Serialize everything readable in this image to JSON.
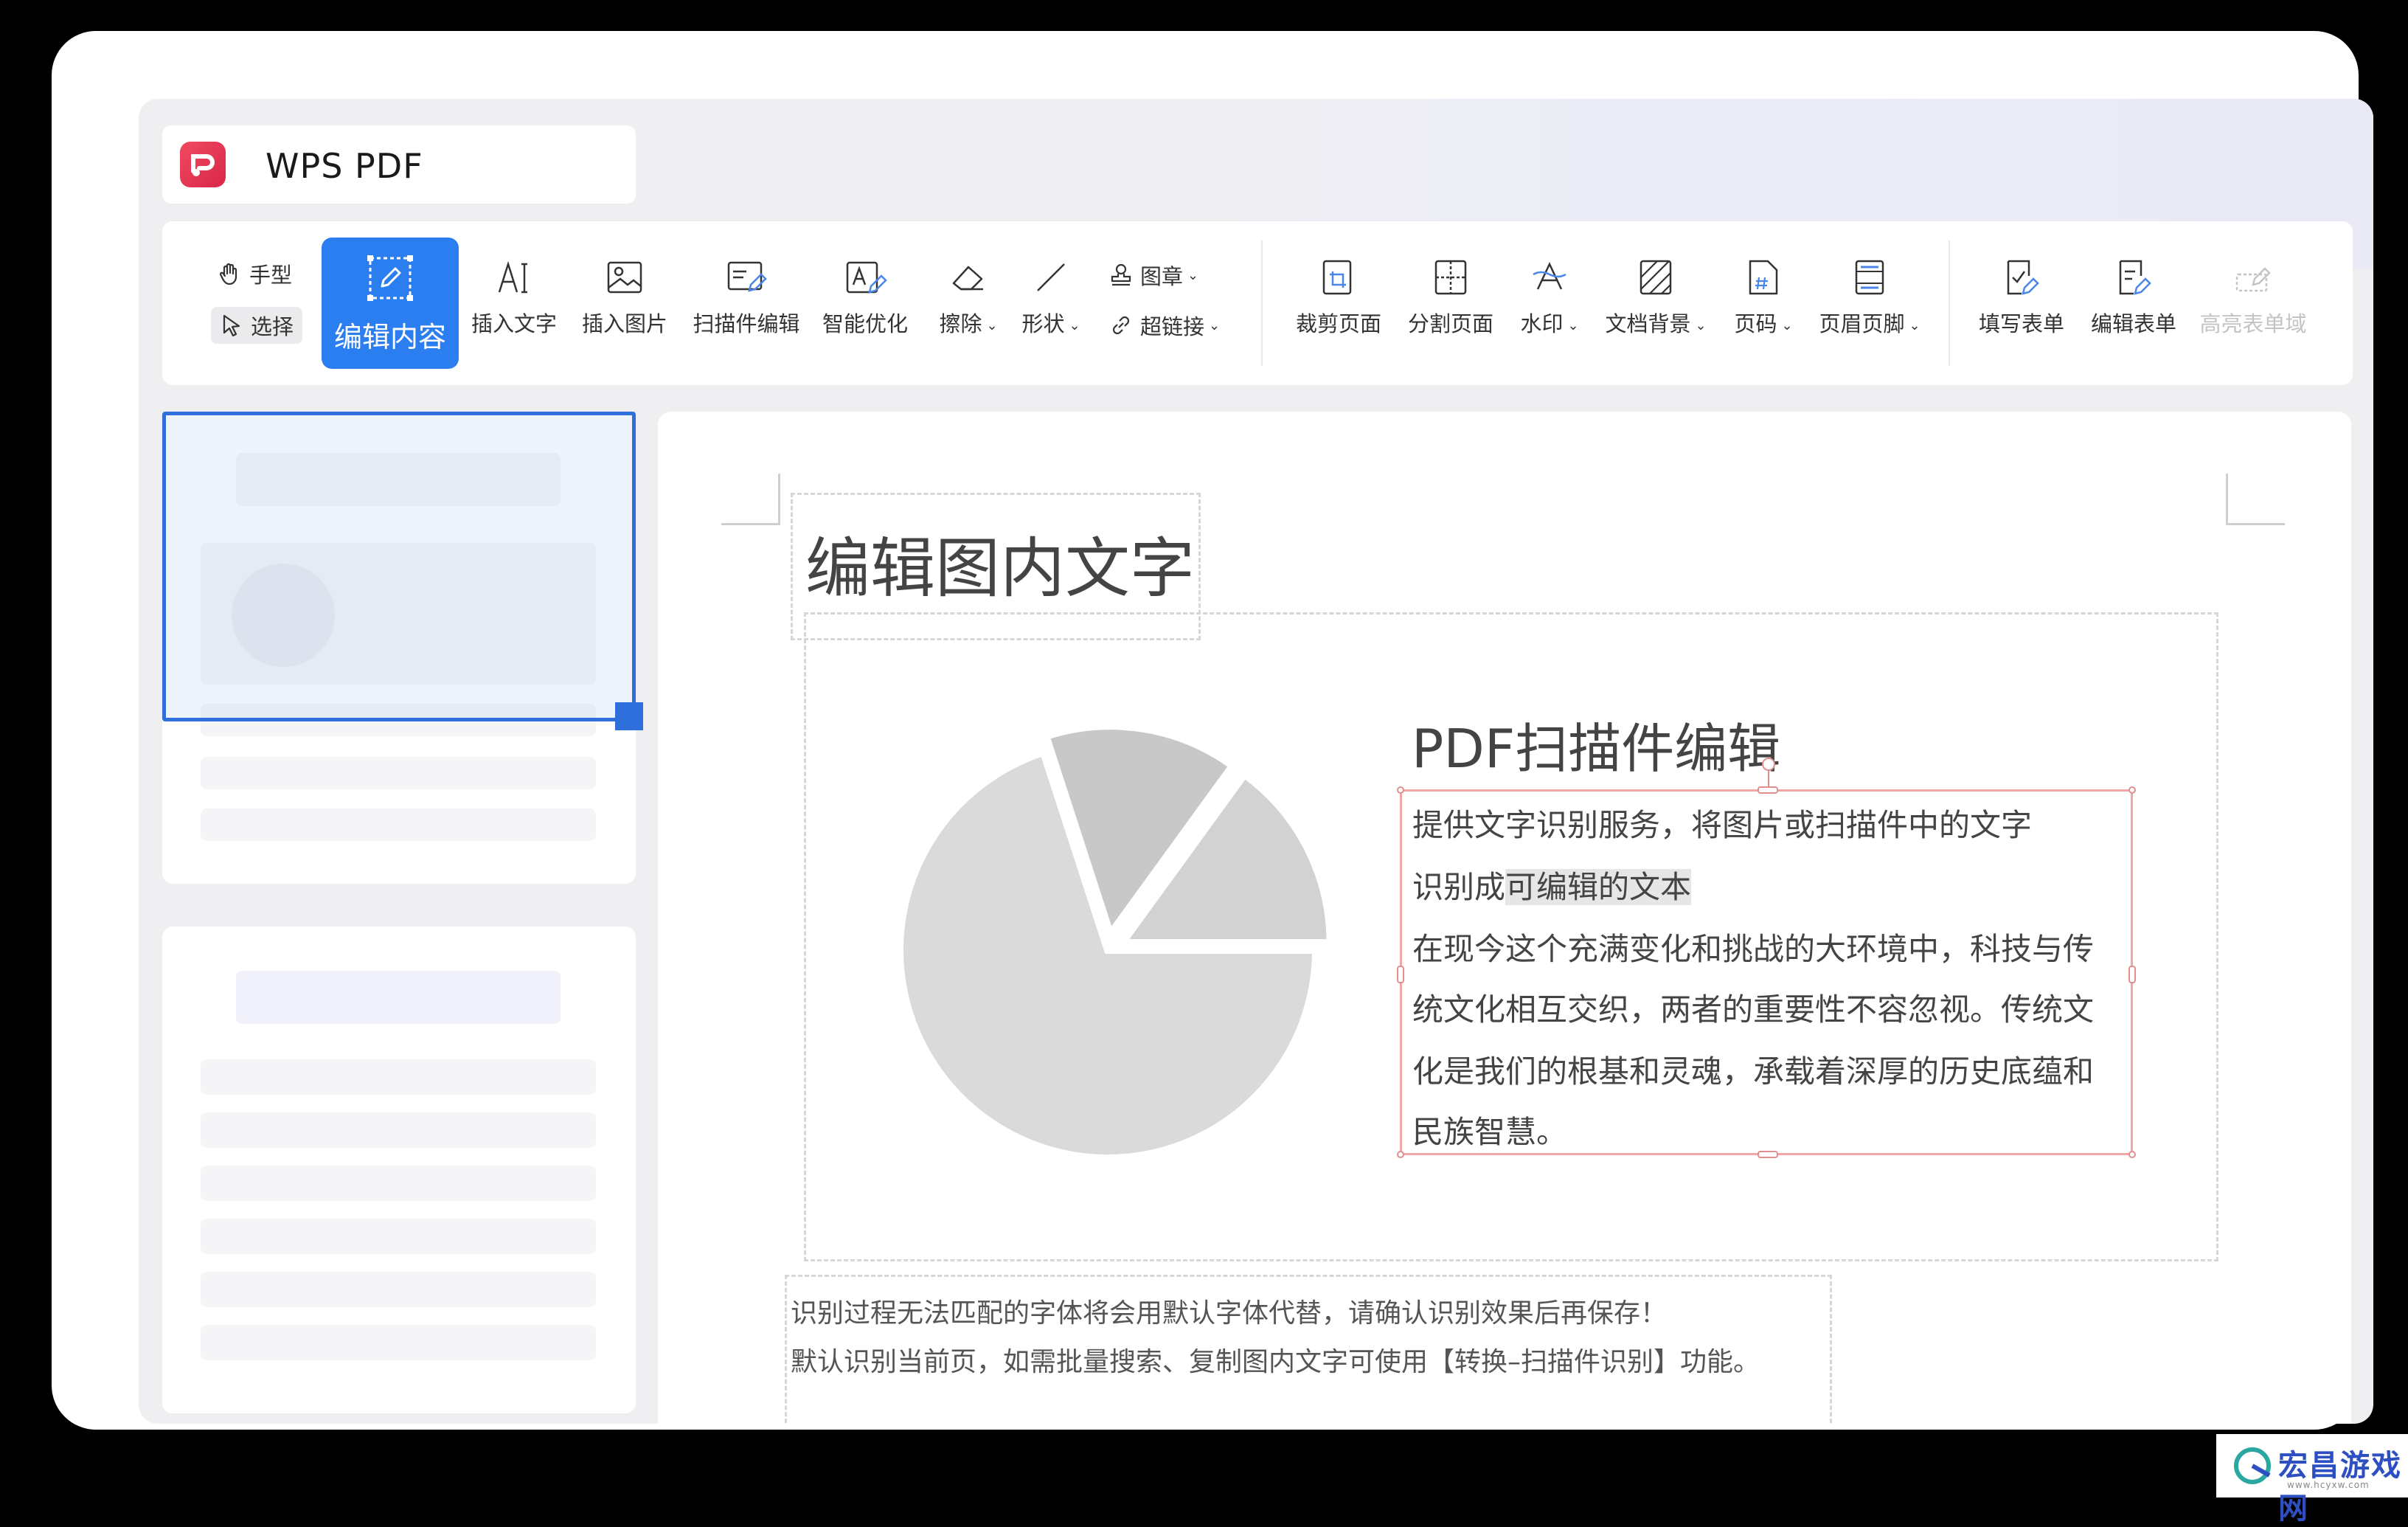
{
  "app": {
    "title": "WPS PDF"
  },
  "toolbar": {
    "hand": "手型",
    "select": "选择",
    "edit_content": "编辑内容",
    "insert_text": "插入文字",
    "insert_image": "插入图片",
    "scan_edit": "扫描件编辑",
    "smart_optimize": "智能优化",
    "erase": "擦除",
    "shape": "形状",
    "stamp": "图章",
    "hyperlink": "超链接",
    "crop_page": "裁剪页面",
    "split_page": "分割页面",
    "watermark": "水印",
    "doc_background": "文档背景",
    "page_number": "页码",
    "header_footer": "页眉页脚",
    "fill_form": "填写表单",
    "edit_form": "编辑表单",
    "highlight_fields": "高亮表单域"
  },
  "document": {
    "heading": "编辑图内文字",
    "subheading": "PDF扫描件编辑",
    "paragraph_lines": [
      "提供文字识别服务，将图片或扫描件中的文字",
      "识别成",
      "可编辑的文本",
      "在现今这个充满变化和挑战的大环境中，科技与传",
      "统文化相互交织，两者的重要性不容忽视。传统文",
      "化是我们的根基和灵魂，承载着深厚的历史底蕴和",
      "民族智慧。"
    ],
    "notice_lines": [
      "识别过程无法匹配的字体将会用默认字体代替，请确认识别效果后再保存！",
      "默认识别当前页，如需批量搜索、复制图内文字可使用【转换–扫描件识别】功能。"
    ]
  },
  "chart": {
    "type": "pie",
    "slices": [
      {
        "name": "large",
        "value": 70,
        "color": "#dadada"
      },
      {
        "name": "left-exploded",
        "value": 15,
        "color": "#c8c8c8"
      },
      {
        "name": "right-exploded",
        "value": 15,
        "color": "#d2d2d2"
      }
    ]
  },
  "watermark": {
    "text": "宏昌游戏网",
    "url": "www.hcyxw.com"
  },
  "colors": {
    "accent": "#2b7ef0",
    "logo": "#e0304f",
    "selection": "#f2a6a6"
  }
}
